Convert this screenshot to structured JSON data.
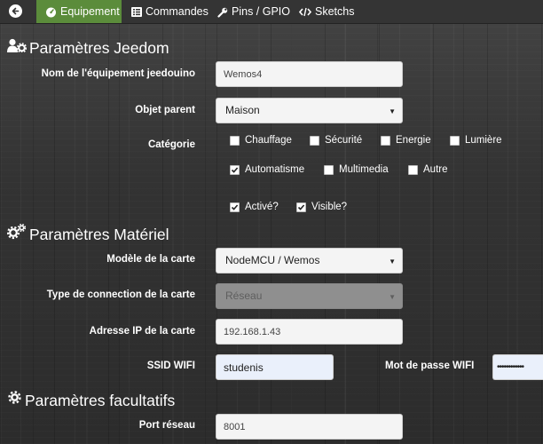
{
  "nav": {
    "tabs": [
      {
        "label": "Equipement",
        "icon": "tachometer-icon",
        "active": true
      },
      {
        "label": "Commandes",
        "icon": "list-icon",
        "active": false
      },
      {
        "label": "Pins / GPIO",
        "icon": "wrench-icon",
        "active": false
      },
      {
        "label": "Sketchs",
        "icon": "code-icon",
        "active": false
      }
    ],
    "active_color": "#5b8c3b"
  },
  "jeedom": {
    "title": "Paramètres Jeedom",
    "name_label": "Nom de l'équipement jeedouino",
    "name_value": "Wemos4",
    "parent_label": "Objet parent",
    "parent_value": "Maison",
    "category_label": "Catégorie",
    "categories": [
      {
        "label": "Chauffage",
        "checked": false
      },
      {
        "label": "Sécurité",
        "checked": false
      },
      {
        "label": "Energie",
        "checked": false
      },
      {
        "label": "Lumière",
        "checked": false
      },
      {
        "label": "Automatisme",
        "checked": true
      },
      {
        "label": "Multimedia",
        "checked": false
      },
      {
        "label": "Autre",
        "checked": false
      }
    ],
    "activated_label": "Activé?",
    "activated_checked": true,
    "visible_label": "Visible?",
    "visible_checked": true
  },
  "materiel": {
    "title": "Paramètres Matériel",
    "model_label": "Modèle de la carte",
    "model_value": "NodeMCU / Wemos",
    "connection_label": "Type de connection de la carte",
    "connection_value": "Réseau",
    "ip_label": "Adresse IP de la carte",
    "ip_value": "192.168.1.43",
    "ssid_label": "SSID WIFI",
    "ssid_value": "studenis",
    "password_label": "Mot de passe WIFI",
    "password_value": "••••••••••••"
  },
  "facultatifs": {
    "title": "Paramètres facultatifs",
    "port_label": "Port réseau",
    "port_value": "8001"
  }
}
